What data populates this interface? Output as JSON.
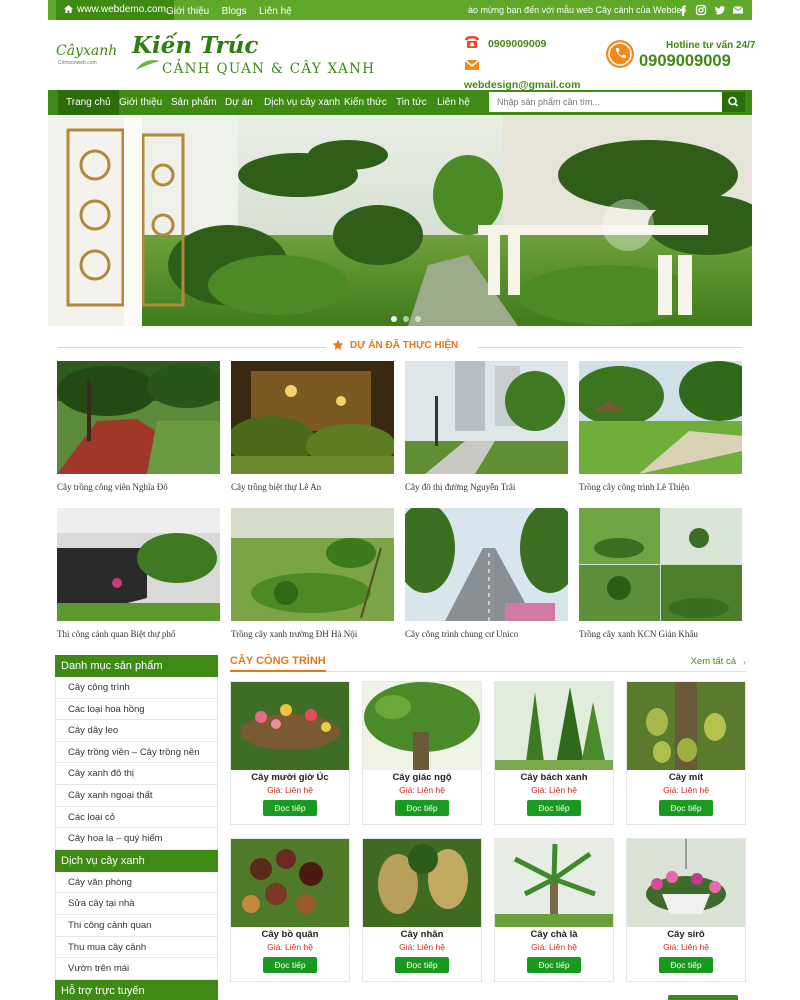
{
  "topbar": {
    "url": "www.webdemo.com",
    "links": [
      "Giới thiệu",
      "Blogs",
      "Liên hệ"
    ],
    "marquee": "ào mừng bạn đến với mẫu web Cây cảnh của Webdesign",
    "social_icons": [
      "facebook-icon",
      "instagram-icon",
      "twitter-icon",
      "mail-icon"
    ]
  },
  "header": {
    "logo_small": "Câyxanh",
    "logo_small_sub": "Crimsonweb.com",
    "brand_script": "Kiến Trúc",
    "brand_sub": "CẢNH QUAN & CÂY XANH",
    "phone": "0909009009",
    "email": "webdesign@gmail.com",
    "hotline_label": "Hotline tư vấn 24/7",
    "hotline_number": "0909009009"
  },
  "nav": {
    "items": [
      "Trang chủ",
      "Giới thiệu",
      "Sản phẩm",
      "Dự án",
      "Dịch vụ cây xanh",
      "Kiến thức",
      "Tin tức",
      "Liên hệ"
    ],
    "active": "Trang chủ",
    "search_placeholder": "Nhập sản phẩm cần tìm..."
  },
  "slider": {
    "slide_count": 3,
    "current": 1
  },
  "projects": {
    "title": "DỰ ÁN ĐÃ THỰC HIỆN",
    "items": [
      {
        "caption": "Cây trồng công viên Nghĩa Đô"
      },
      {
        "caption": "Cây trồng biệt thự Lê An"
      },
      {
        "caption": "Cây đô thị đường Nguyễn Trãi"
      },
      {
        "caption": "Trồng cây công trình Lê Thiện"
      },
      {
        "caption": "Thi công cảnh quan Biệt thự phố"
      },
      {
        "caption": "Trồng cây xanh trường ĐH Hà Nội"
      },
      {
        "caption": "Cây công trình chung cư Unico"
      },
      {
        "caption": "Trồng cây xanh KCN Gián Khẩu"
      }
    ]
  },
  "sidebar": {
    "categories_title": "Danh mục sản phẩm",
    "categories": [
      "Cây công trình",
      "Các loại hoa hồng",
      "Cây dây leo",
      "Cây trồng viền – Cây trồng nền",
      "Cây xanh đô thị",
      "Cây xanh ngoại thất",
      "Các loại cỏ",
      "Cây hoa lạ – quý hiếm"
    ],
    "services_title": "Dịch vụ cây xanh",
    "services": [
      "Cây văn phòng",
      "Sửa cây tại nhà",
      "Thi công cảnh quan",
      "Thu mua cây cảnh",
      "Vườn trên mái"
    ],
    "support_title": "Hỗ trợ trực tuyến"
  },
  "products": {
    "title": "CÂY CÔNG TRÌNH",
    "view_all": "Xem tất cả",
    "price_label": "Giá: Liên hệ",
    "button_label": "Đọc tiếp",
    "items": [
      {
        "name": "Cây mười giờ Úc"
      },
      {
        "name": "Cây giác ngộ"
      },
      {
        "name": "Cây bách xanh"
      },
      {
        "name": "Cây mít"
      },
      {
        "name": "Cây bồ quân"
      },
      {
        "name": "Cây nhãn"
      },
      {
        "name": "Cây chà là"
      },
      {
        "name": "Cây sirô"
      }
    ]
  },
  "colors": {
    "primary_green": "#3f8a14",
    "dark_green": "#2b6d08",
    "accent_orange": "#e07a1a",
    "price_red": "#d6281f",
    "button_green": "#189a1e"
  }
}
